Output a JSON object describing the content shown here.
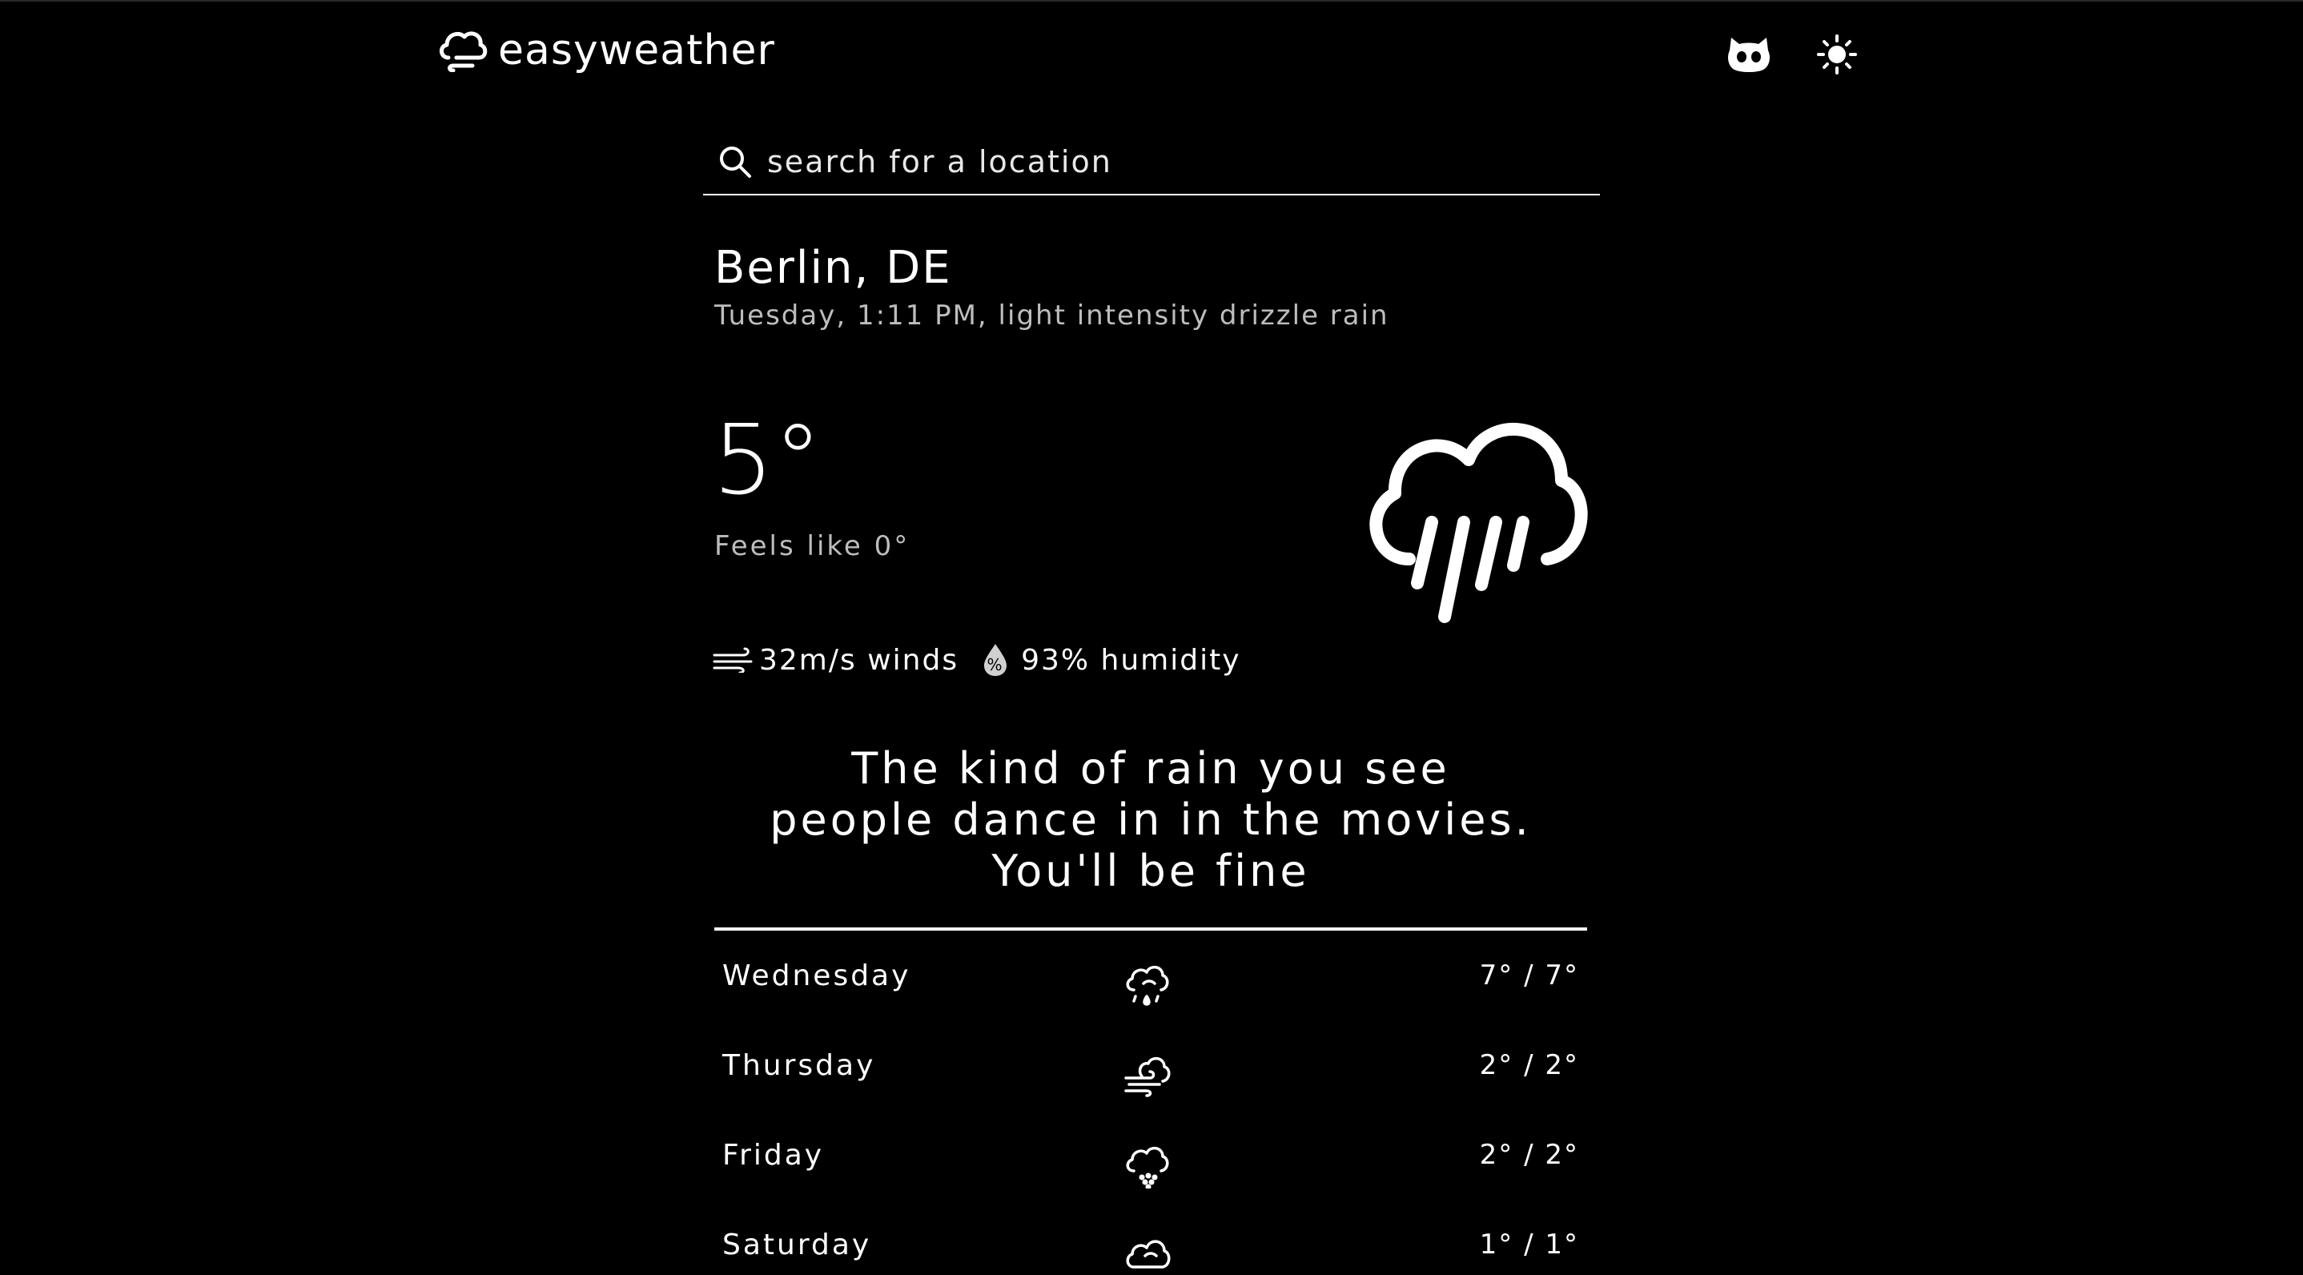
{
  "app": {
    "brand_name": "easyweather",
    "logo_icon": "cloud-logo-icon",
    "github_icon": "github-cat-icon",
    "theme_icon": "sun-icon"
  },
  "search": {
    "placeholder": "search for a location",
    "value": ""
  },
  "location": {
    "title": "Berlin, DE",
    "subtitle": "Tuesday, 1:11 PM, light intensity drizzle rain"
  },
  "current": {
    "temperature": "5°",
    "feels_like": "Feels like 0°",
    "condition_icon": "rain-cloud-icon",
    "wind": "32m/s winds",
    "humidity": "93% humidity"
  },
  "tagline": {
    "line1": "The kind of rain you see",
    "line2": "people dance in in the movies.",
    "line3": "You'll be fine"
  },
  "forecast": [
    {
      "day": "Wednesday",
      "icon": "cloud-drizzle-icon",
      "temp": "7° / 7°"
    },
    {
      "day": "Thursday",
      "icon": "cloud-wind-icon",
      "temp": "2° / 2°"
    },
    {
      "day": "Friday",
      "icon": "cloud-snow-icon",
      "temp": "2° / 2°"
    },
    {
      "day": "Saturday",
      "icon": "cloud-icon",
      "temp": "1° / 1°"
    }
  ],
  "colors": {
    "background": "#000000",
    "text": "#ffffff",
    "muted": "#bdbdbd"
  }
}
